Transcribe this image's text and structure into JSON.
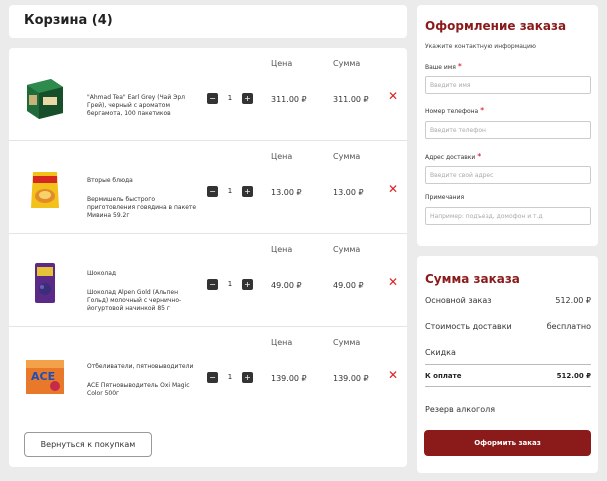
{
  "cart": {
    "title": "Корзина (4)",
    "price_header": "Цена",
    "sum_header": "Сумма",
    "remove_glyph": "✕",
    "qty_minus": "−",
    "qty_plus": "+",
    "back_button": "Вернуться к покупкам",
    "items": [
      {
        "category": "",
        "name": "\"Ahmad Tea\" Earl Grey (Чай Эрл Грей), черный с ароматом бергамота, 100 пакетиков",
        "qty": "1",
        "price": "311.00 ₽",
        "sum": "311.00 ₽",
        "image": "tea-box-image"
      },
      {
        "category": "Вторые блюда",
        "name": "Вермишель быстрого приготовления говядина в пакете Мивина 59.2г",
        "qty": "1",
        "price": "13.00 ₽",
        "sum": "13.00 ₽",
        "image": "noodles-pack-image"
      },
      {
        "category": "Шоколад",
        "name": "Шоколад Alpen Gold (Альпен Гольд) молочный с чернично-йогуртовой начинкой 85 г",
        "qty": "1",
        "price": "49.00 ₽",
        "sum": "49.00 ₽",
        "image": "chocolate-bar-image"
      },
      {
        "category": "Отбеливатели, пятновыводители",
        "name": "ACE Пятновыводитель Oxi Magic Color 500г",
        "qty": "1",
        "price": "139.00 ₽",
        "sum": "139.00 ₽",
        "image": "stain-remover-box-image"
      }
    ]
  },
  "order": {
    "title": "Оформление заказа",
    "subtitle": "Укажите контактную информацию",
    "req_mark": "*",
    "fields": {
      "name": {
        "label": "Ваше имя",
        "placeholder": "Введите имя",
        "required": true
      },
      "phone": {
        "label": "Номер телефона",
        "placeholder": "Введите телефон",
        "required": true
      },
      "address": {
        "label": "Адрес доставки",
        "placeholder": "Введите свой адрес",
        "required": true
      },
      "notes": {
        "label": "Примечания",
        "placeholder": "Например: подъезд, домофон и т.д",
        "required": false
      }
    }
  },
  "summary": {
    "title": "Сумма заказа",
    "base_label": "Основной заказ",
    "base_value": "512.00 ₽",
    "delivery_label": "Стоимость доставки",
    "delivery_value": "бесплатно",
    "discount_label": "Скидка",
    "total_label": "К оплате",
    "total_value": "512.00 ₽",
    "alcohol_label": "Резерв алкоголя",
    "checkout_button": "Оформить заказ"
  },
  "colors": {
    "accent": "#8b1a1a",
    "remove": "#e02020",
    "background": "#ebebeb"
  }
}
